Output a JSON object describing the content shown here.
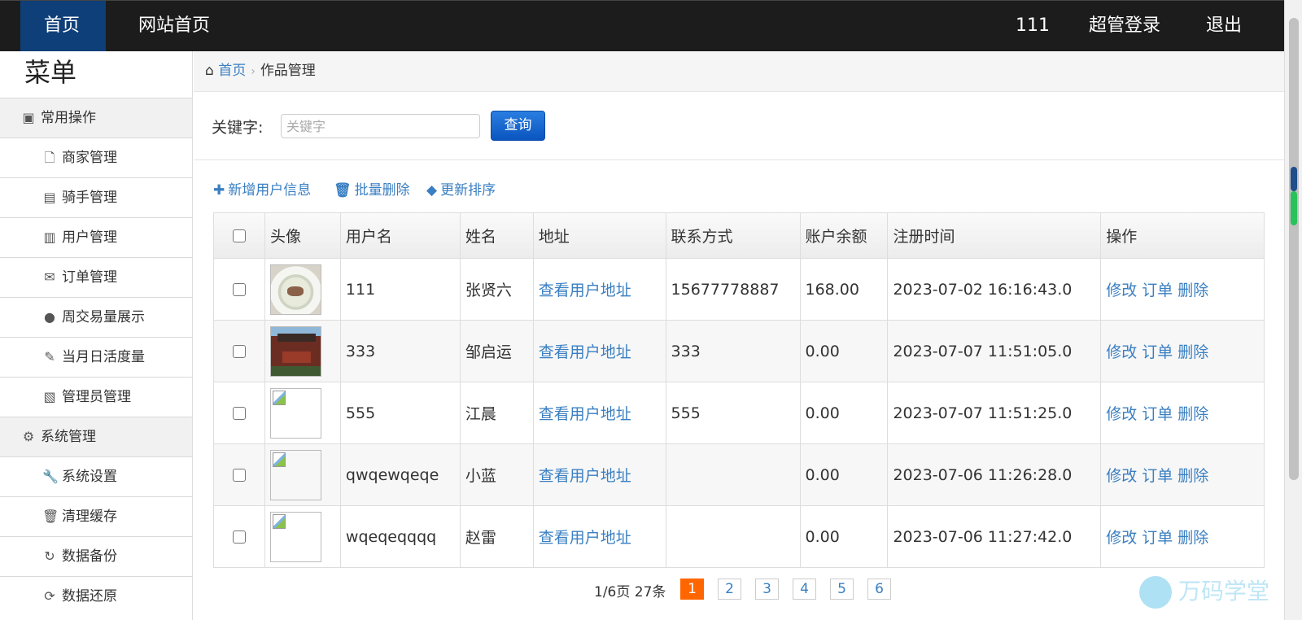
{
  "topnav": {
    "home": "首页",
    "site_home": "网站首页",
    "user": "111",
    "admin_login": "超管登录",
    "logout": "退出"
  },
  "sidebar": {
    "title": "菜单",
    "groups": [
      {
        "label": "常用操作",
        "items": [
          "商家管理",
          "骑手管理",
          "用户管理",
          "订单管理",
          "周交易量展示",
          "当月日活度量",
          "管理员管理"
        ]
      },
      {
        "label": "系统管理",
        "items": [
          "系统设置",
          "清理缓存",
          "数据备份",
          "数据还原"
        ]
      }
    ]
  },
  "breadcrumb": {
    "home": "首页",
    "current": "作品管理"
  },
  "search": {
    "label": "关键字:",
    "placeholder": "关键字",
    "value": "",
    "button": "查询"
  },
  "toolbar": {
    "add": "新增用户信息",
    "batch_delete": "批量删除",
    "update_sort": "更新排序"
  },
  "table": {
    "headers": [
      "头像",
      "用户名",
      "姓名",
      "地址",
      "联系方式",
      "账户余额",
      "注册时间",
      "操作"
    ],
    "rows": [
      {
        "avatar": "food",
        "username": "111",
        "name": "张贤六",
        "address": "查看用户地址",
        "contact": "15677778887",
        "balance": "168.00",
        "registered": "2023-07-02 16:16:43.0"
      },
      {
        "avatar": "tower",
        "username": "333",
        "name": "邹启运",
        "address": "查看用户地址",
        "contact": "333",
        "balance": "0.00",
        "registered": "2023-07-07 11:51:05.0"
      },
      {
        "avatar": "broken",
        "username": "555",
        "name": "江晨",
        "address": "查看用户地址",
        "contact": "555",
        "balance": "0.00",
        "registered": "2023-07-07 11:51:25.0"
      },
      {
        "avatar": "broken",
        "username": "qwqewqeqe",
        "name": "小蓝",
        "address": "查看用户地址",
        "contact": "",
        "balance": "0.00",
        "registered": "2023-07-06 11:26:28.0"
      },
      {
        "avatar": "broken",
        "username": "wqeqeqqqq",
        "name": "赵雷",
        "address": "查看用户地址",
        "contact": "",
        "balance": "0.00",
        "registered": "2023-07-06 11:27:42.0"
      }
    ],
    "actions": {
      "edit": "修改",
      "order": "订单",
      "delete": "删除"
    }
  },
  "pagination": {
    "info": "1/6页 27条",
    "pages": [
      "1",
      "2",
      "3",
      "4",
      "5",
      "6"
    ],
    "current": "1"
  },
  "watermark": "万码学堂",
  "colors": {
    "topbar": "#1c1c1c",
    "active_nav": "#0f3f78",
    "link": "#3a7fc2",
    "pager_current": "#ff6600",
    "search_button": "#0a55c0"
  }
}
